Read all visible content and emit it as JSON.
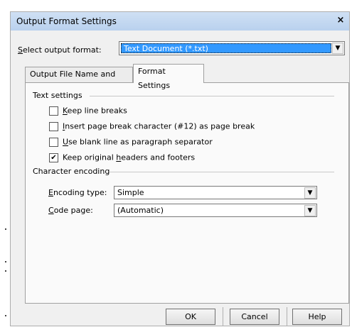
{
  "dialog": {
    "title": "Output Format Settings",
    "close_glyph": "×"
  },
  "format": {
    "label_key": "S",
    "label_rest": "elect output format:",
    "value": "Text Document (*.txt)"
  },
  "tabs": [
    {
      "label": "Output File Name and Path",
      "active": false
    },
    {
      "label": "Format Settings",
      "active": true
    }
  ],
  "text_settings": {
    "heading": "Text settings",
    "options": [
      {
        "key": "K",
        "rest": "eep line breaks",
        "checked": false
      },
      {
        "key": "I",
        "rest": "nsert page break character (#12) as page break",
        "checked": false
      },
      {
        "key": "U",
        "rest": "se blank line as paragraph separator",
        "checked": false
      },
      {
        "pre": "Keep original ",
        "key": "h",
        "rest": "eaders and footers",
        "checked": true
      }
    ]
  },
  "encoding": {
    "heading": "Character encoding",
    "type_key": "E",
    "type_rest": "ncoding type:",
    "type_value": "Simple",
    "page_key": "C",
    "page_rest": "ode page:",
    "page_value": "(Automatic)"
  },
  "buttons": {
    "ok": "OK",
    "cancel": "Cancel",
    "help": "Help"
  },
  "icons": {
    "dropdown_arrow": "▼",
    "check_mark": "✔"
  }
}
